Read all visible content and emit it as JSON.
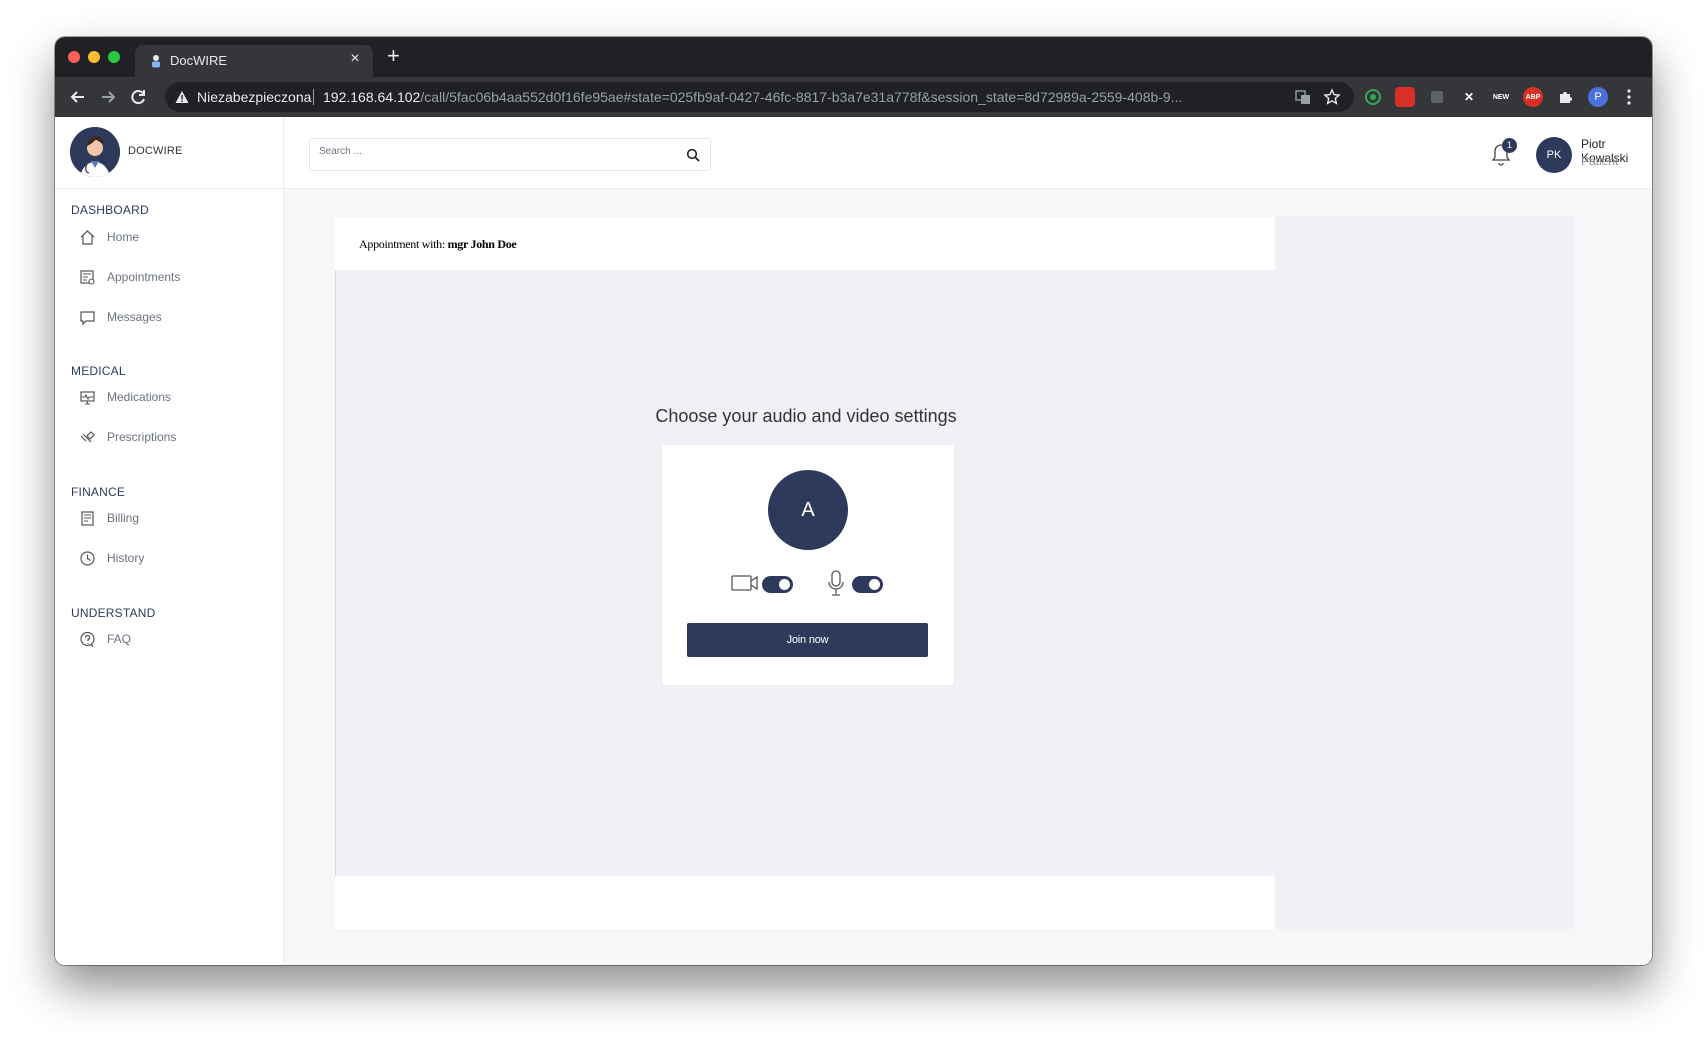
{
  "browser": {
    "tab_title": "DocWIRE",
    "tab_close": "×",
    "new_tab": "+",
    "security_label": "Niezabezpieczona",
    "url_host": "192.168.64.102",
    "url_path": "/call/5fac06b4aa552d0f16fe95ae#state=025fb9af-0427-46fc-8817-b3a7e31a778f&session_state=8d72989a-2559-408b-9...",
    "profile_initial": "P",
    "extensions": [
      "circle-green-extension",
      "red-extension",
      "dark-extension",
      "x-extension",
      "new-extension",
      "abp-extension",
      "puzzle-extensions"
    ],
    "ext_labels": {
      "x": "✕",
      "new": "NEW",
      "abp": "ABP"
    }
  },
  "brand": {
    "name": "DOCWIRE"
  },
  "sidebar": {
    "sections": [
      {
        "title": "DASHBOARD",
        "items": [
          {
            "label": "Home",
            "icon": "home-icon"
          },
          {
            "label": "Appointments",
            "icon": "appointments-icon"
          },
          {
            "label": "Messages",
            "icon": "messages-icon"
          }
        ]
      },
      {
        "title": "MEDICAL",
        "items": [
          {
            "label": "Medications",
            "icon": "medications-icon"
          },
          {
            "label": "Prescriptions",
            "icon": "prescriptions-icon"
          }
        ]
      },
      {
        "title": "FINANCE",
        "items": [
          {
            "label": "Billing",
            "icon": "billing-icon"
          },
          {
            "label": "History",
            "icon": "history-icon"
          }
        ]
      },
      {
        "title": "UNDERSTAND",
        "items": [
          {
            "label": "FAQ",
            "icon": "faq-icon"
          }
        ]
      }
    ]
  },
  "header": {
    "search_placeholder": "Search ...",
    "notifications_count": "1",
    "user_initials": "PK",
    "user_name": "Piotr Kowalski",
    "user_role": "Patient"
  },
  "call": {
    "appointment_prefix": "Appointment with:",
    "appointment_with": "mgr John Doe",
    "settings_title": "Choose your audio and video settings",
    "avatar_initial": "A",
    "camera_enabled": true,
    "microphone_enabled": true,
    "join_label": "Join now"
  },
  "colors": {
    "primary": "#2d3a5c",
    "background": "#f7f7fa",
    "stage": "#f0f0f6"
  }
}
